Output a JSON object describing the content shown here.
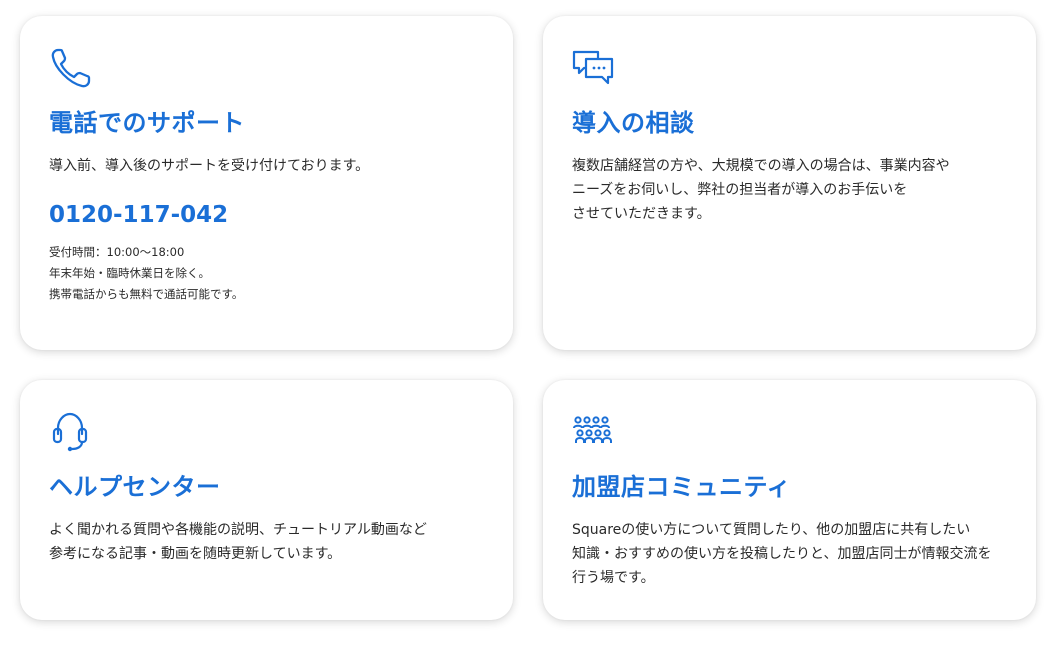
{
  "colors": {
    "accent": "#1a6fd6",
    "text": "#2a2a2a",
    "card_bg": "#ffffff"
  },
  "cards": [
    {
      "icon": "phone-icon",
      "title": "電話でのサポート",
      "desc": [
        "導入前、導入後のサポートを受け付けております。"
      ],
      "phone": "0120-117-042",
      "notes": [
        "受付時間：10:00〜18:00",
        "年末年始・臨時休業日を除く。",
        "携帯電話からも無料で通話可能です。"
      ]
    },
    {
      "icon": "chat-bubbles-icon",
      "title": "導入の相談",
      "desc": [
        "複数店舗経営の方や、大規模での導入の場合は、事業内容や",
        "ニーズをお伺いし、弊社の担当者が導入のお手伝いを",
        "させていただきます。"
      ]
    },
    {
      "icon": "headset-icon",
      "title": "ヘルプセンター",
      "desc": [
        "よく聞かれる質問や各機能の説明、チュートリアル動画など",
        "参考になる記事・動画を随時更新しています。"
      ]
    },
    {
      "icon": "community-icon",
      "title": "加盟店コミュニティ",
      "desc": [
        "Squareの使い方について質問したり、他の加盟店に共有したい",
        "知識・おすすめの使い方を投稿したりと、加盟店同士が情報交流を",
        "行う場です。"
      ]
    }
  ]
}
